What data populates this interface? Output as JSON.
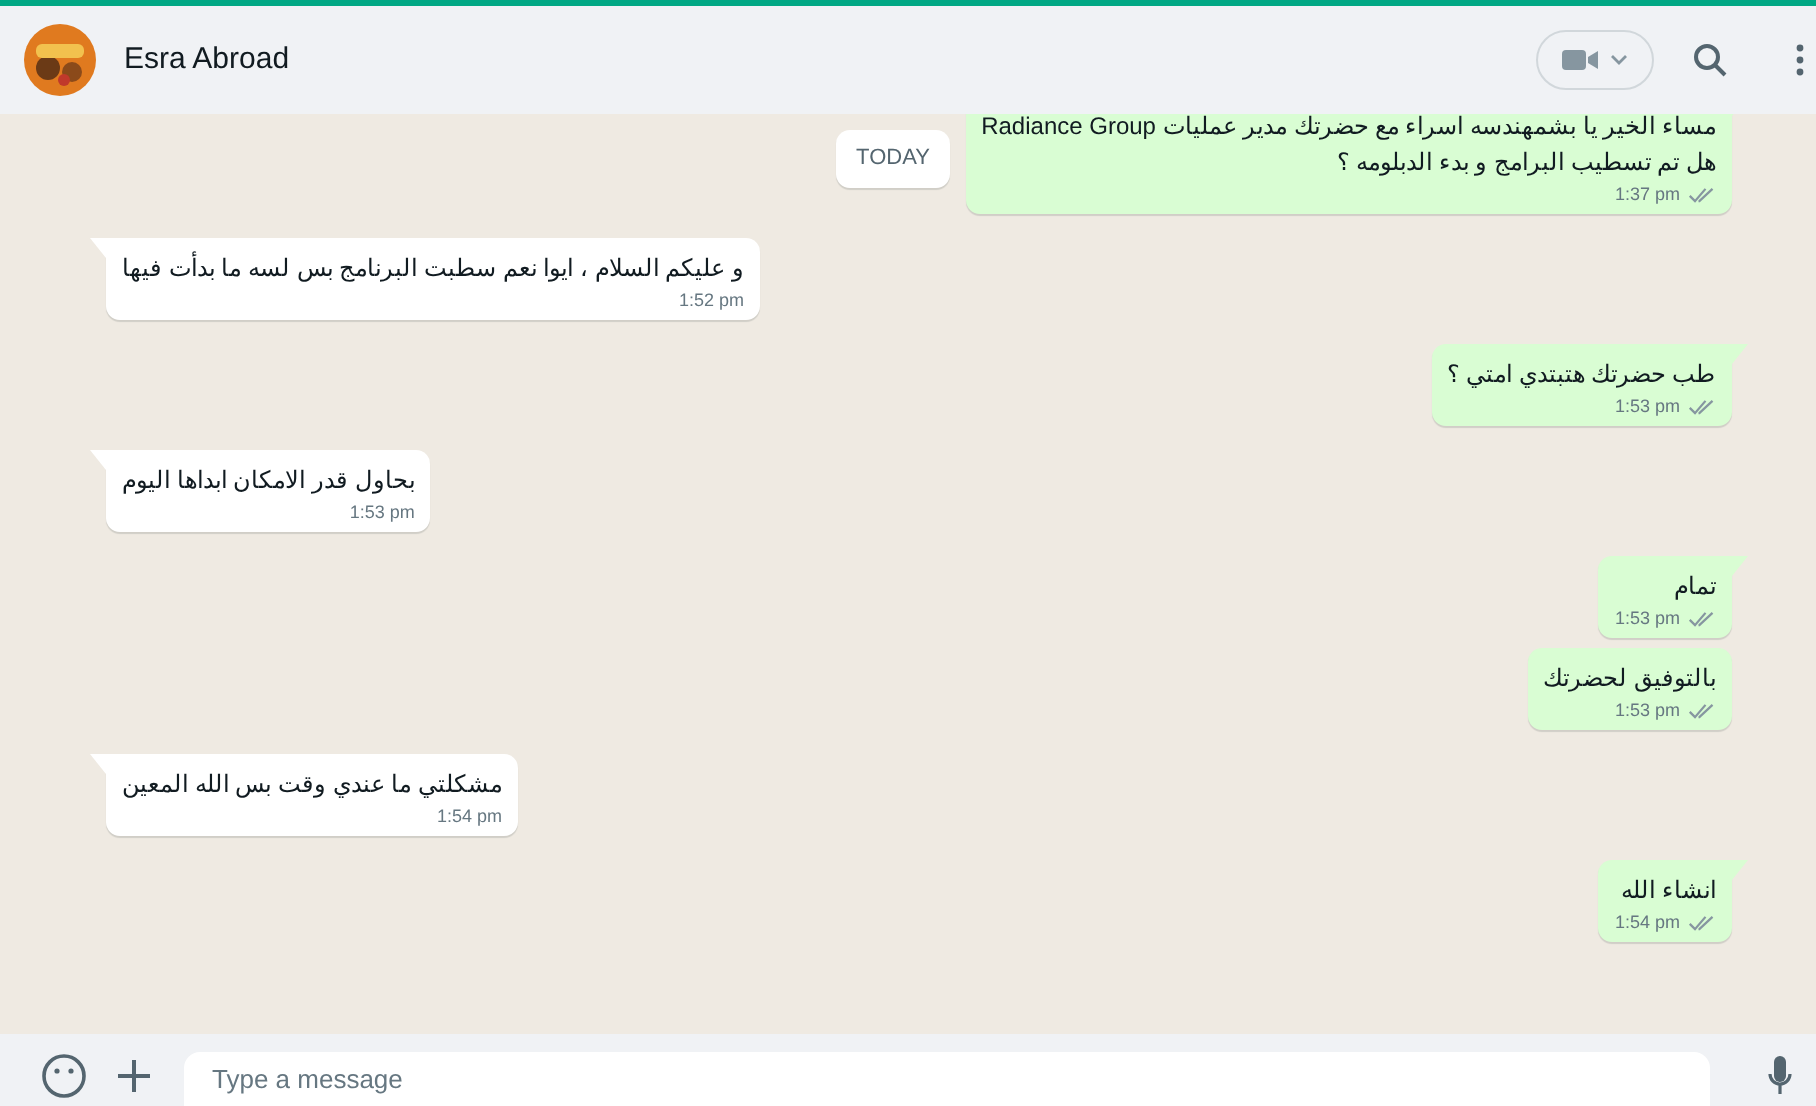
{
  "header": {
    "contact_name": "Esra Abroad"
  },
  "date_badge": "TODAY",
  "messages": [
    {
      "kind": "outgoing",
      "text": "مساء الخير يا بشمهندسه اسراء مع حضرتك مدير عمليات Radiance Group\nهل تم تسطيب البرامج و بدء الدبلومه ؟",
      "time": "1:37 pm"
    },
    {
      "kind": "incoming",
      "text": "و عليكم السلام ، ايوا نعم سطبت البرنامج بس لسه ما بدأت فيها",
      "time": "1:52 pm"
    },
    {
      "kind": "outgoing",
      "text": "طب حضرتك هتبتدي امتي ؟",
      "time": "1:53 pm"
    },
    {
      "kind": "incoming",
      "text": "بحاول قدر الامكان ابداها اليوم",
      "time": "1:53 pm"
    },
    {
      "kind": "outgoing",
      "text": "تمام",
      "time": "1:53 pm"
    },
    {
      "kind": "outgoing",
      "text": "بالتوفيق لحضرتك",
      "time": "1:53 pm"
    },
    {
      "kind": "incoming",
      "text": "مشكلتي ما عندي وقت بس الله المعين",
      "time": "1:54 pm"
    },
    {
      "kind": "outgoing",
      "text": "انشاء الله",
      "time": "1:54 pm"
    }
  ],
  "composer": {
    "placeholder": "Type a message"
  }
}
